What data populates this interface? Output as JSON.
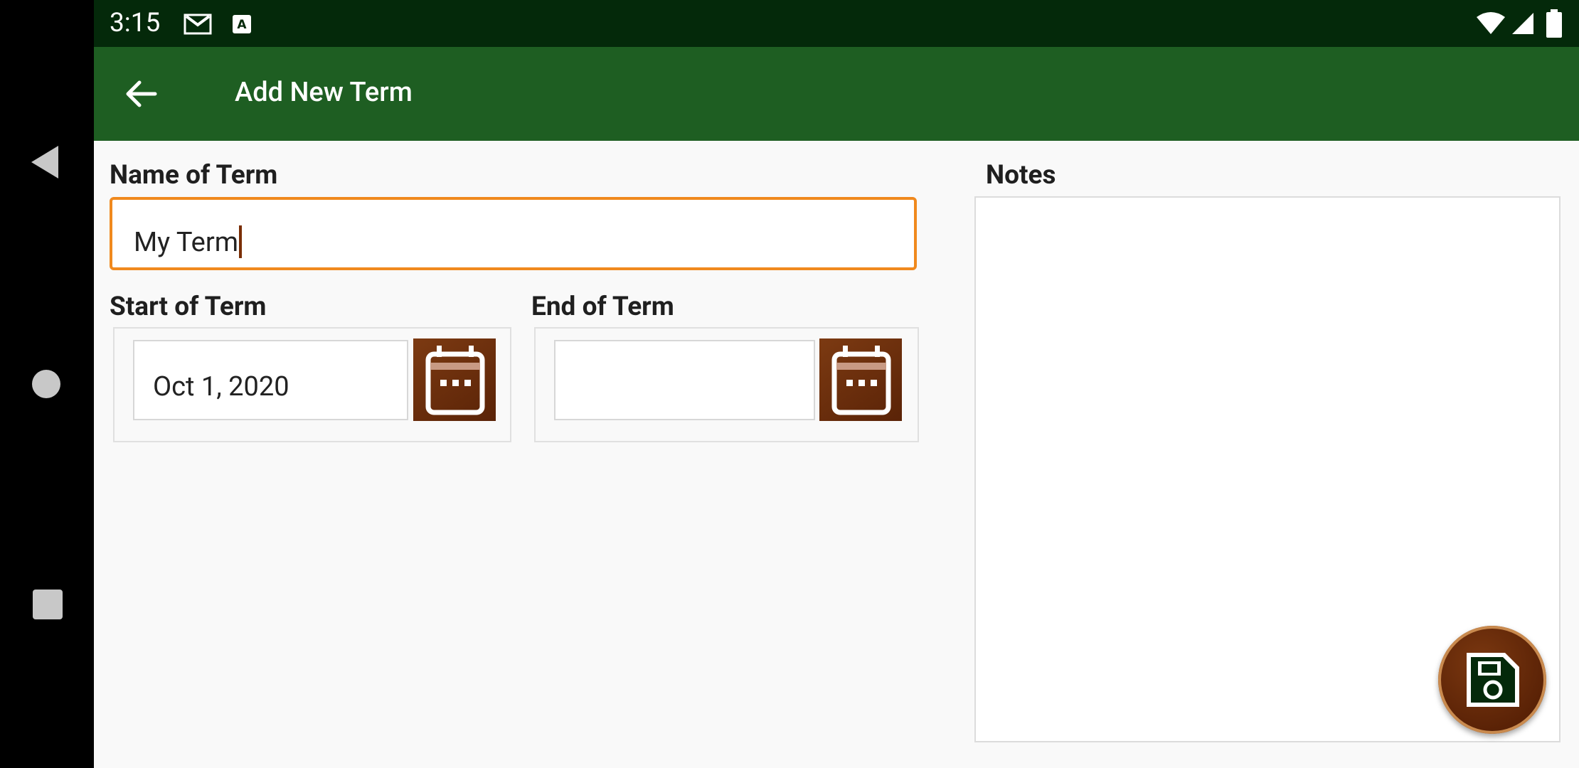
{
  "status_bar": {
    "time": "3:15",
    "icons": [
      "gmail-icon",
      "a-icon",
      "wifi-icon",
      "signal-icon",
      "battery-icon"
    ]
  },
  "app_bar": {
    "title": "Add New Term",
    "back_icon": "arrow-left-icon",
    "background": "#1e5e22"
  },
  "form": {
    "name_label": "Name of Term",
    "name_value": "My Term",
    "start_label": "Start of Term",
    "start_value": "Oct 1, 2020",
    "end_label": "End of Term",
    "end_value": "",
    "notes_label": "Notes",
    "notes_value": ""
  },
  "fab": {
    "icon": "save-icon"
  },
  "colors": {
    "accent_focus": "#f0891e",
    "button_brown": "#6b2c0a",
    "status_bar": "#04290a"
  },
  "nav_bar": {
    "icons": [
      "back-triangle-icon",
      "home-circle-icon",
      "recents-square-icon"
    ]
  }
}
